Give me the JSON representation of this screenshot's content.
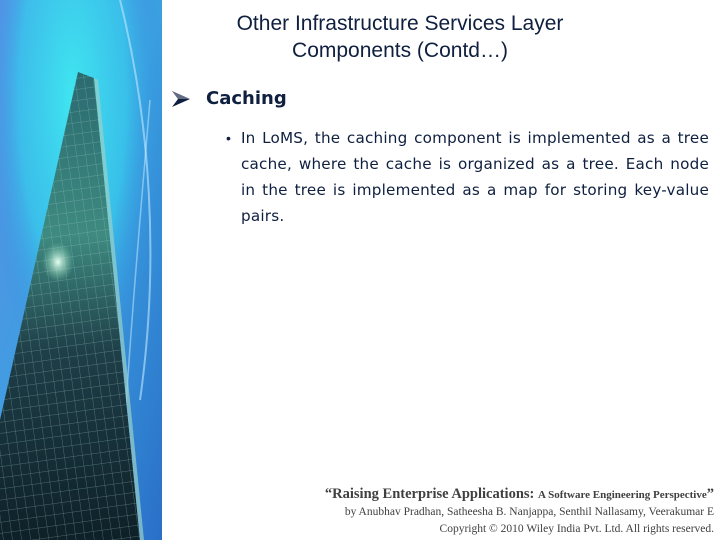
{
  "slide": {
    "title_line1": "Other Infrastructure Services Layer",
    "title_line2": "Components (Contd…)",
    "heading": "Caching",
    "bullets": [
      "In LoMS, the caching component is implemented as a tree cache, where the cache is organized as a tree. Each node in the tree is implemented as a map for storing key-value pairs."
    ],
    "side_image": "skyscraper-photo",
    "heading_icon": "arrow-bullet-icon"
  },
  "footer": {
    "book_title_open": "“Raising Enterprise Applications: ",
    "book_subtitle": "A Software Engineering Perspective",
    "book_title_close": "”",
    "authors": "by Anubhav Pradhan, Satheesha B. Nanjappa, Senthil Nallasamy, Veerakumar E",
    "copyright": "Copyright © 2010 Wiley India Pvt. Ltd.  All rights reserved."
  },
  "colors": {
    "text_primary": "#0f1f3f",
    "footer_text": "#404040"
  }
}
